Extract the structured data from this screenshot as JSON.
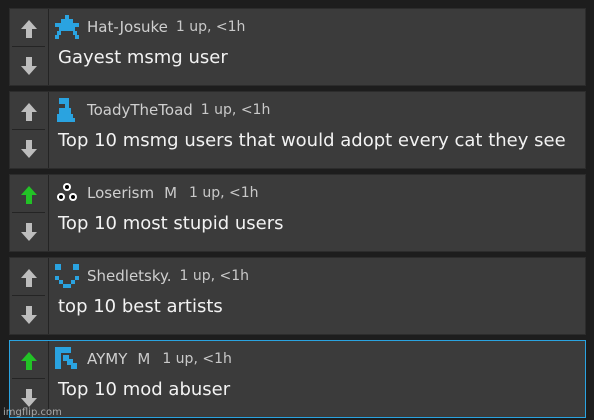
{
  "colors": {
    "upvote_active": "#22c226",
    "vote_inactive": "#bdbdbd",
    "avatar_blue": "#2aa3e0",
    "highlight_border": "#2aa3e0"
  },
  "comments": [
    {
      "username": "Hat-Josuke",
      "badge": "",
      "meta": "1 up, <1h",
      "text": "Gayest msmg user",
      "upvoted": false,
      "avatar_icon": "pixel-creature-icon"
    },
    {
      "username": "ToadyTheToad",
      "badge": "",
      "meta": "1 up, <1h",
      "text": "Top 10 msmg users that would adopt every cat they see",
      "upvoted": false,
      "avatar_icon": "pixel-figure-icon"
    },
    {
      "username": "Loserism",
      "badge": "M",
      "meta": "1 up, <1h",
      "text": "Top 10 most stupid users",
      "upvoted": true,
      "avatar_icon": "triforce-dots-icon"
    },
    {
      "username": "Shedletsky.",
      "badge": "",
      "meta": "1 up, <1h",
      "text": "top 10 best artists",
      "upvoted": false,
      "avatar_icon": "pixel-smile-icon"
    },
    {
      "username": "AYMY",
      "badge": "M",
      "meta": "1 up, <1h",
      "text": "Top 10 mod abuser",
      "upvoted": true,
      "avatar_icon": "pixel-arrow-icon"
    }
  ],
  "watermark": "imgflip.com"
}
